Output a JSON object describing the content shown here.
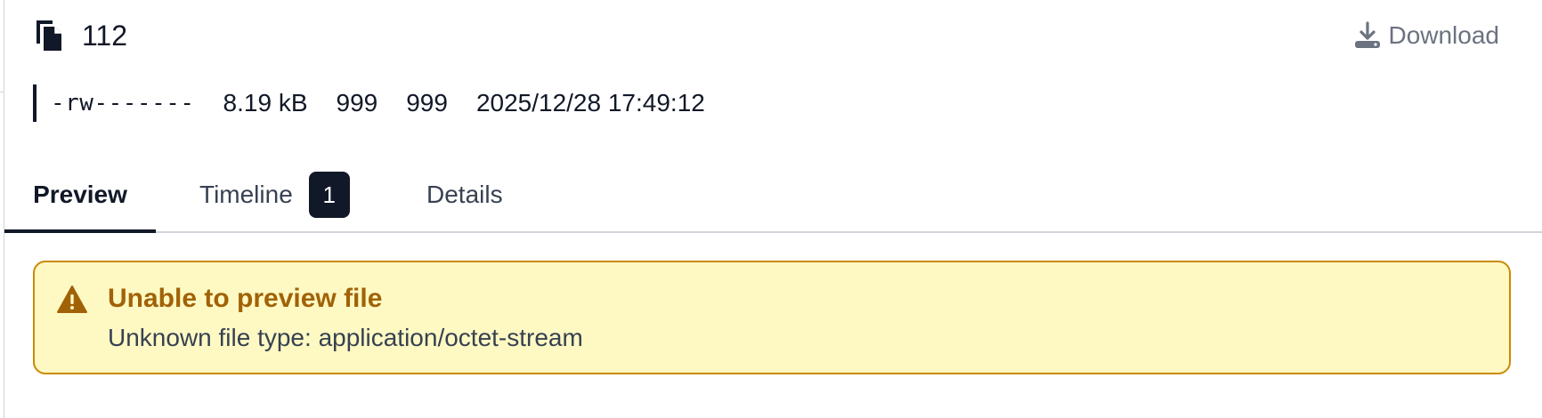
{
  "file": {
    "name": "112",
    "icon": "file-copy-icon",
    "download_label": "Download",
    "download_icon": "download-icon"
  },
  "meta": {
    "permissions": "-rw-------",
    "size": "8.19 kB",
    "uid": "999",
    "gid": "999",
    "modified": "2025/12/28 17:49:12"
  },
  "tabs": [
    {
      "label": "Preview",
      "active": true
    },
    {
      "label": "Timeline",
      "badge": "1",
      "active": false
    },
    {
      "label": "Details",
      "active": false
    }
  ],
  "alert": {
    "icon": "warning-icon",
    "title": "Unable to preview file",
    "message": "Unknown file type: application/octet-stream",
    "colors": {
      "background": "#fef9c3",
      "border": "#ca8a04",
      "title": "#a16207"
    }
  },
  "colors": {
    "primary": "#111827",
    "muted": "#6b7280",
    "divider": "#d1d5db"
  }
}
